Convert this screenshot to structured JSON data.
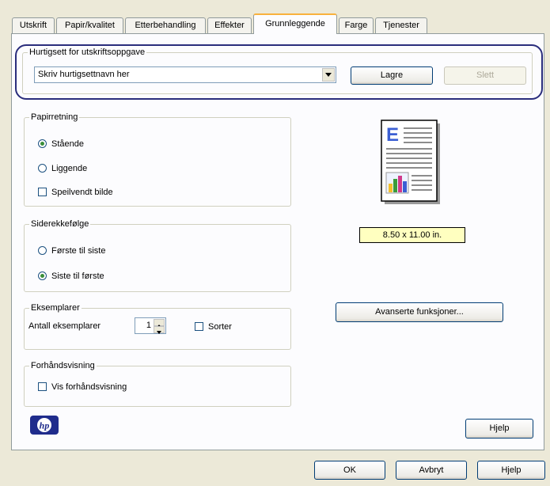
{
  "tabs": [
    {
      "label": "Utskrift"
    },
    {
      "label": "Papir/kvalitet"
    },
    {
      "label": "Etterbehandling"
    },
    {
      "label": "Effekter"
    },
    {
      "label": "Grunnleggende",
      "active": true
    },
    {
      "label": "Farge"
    },
    {
      "label": "Tjenester"
    }
  ],
  "quickset": {
    "title": "Hurtigsett for utskriftsoppgave",
    "value": "Skriv hurtigsettnavn her",
    "save_label": "Lagre",
    "delete_label": "Slett"
  },
  "orientation": {
    "title": "Papirretning",
    "portrait": "Stående",
    "landscape": "Liggende",
    "mirror": "Speilvendt bilde",
    "selected": "portrait"
  },
  "page_order": {
    "title": "Siderekkefølge",
    "first_to_last": "Første til siste",
    "last_to_first": "Siste til første",
    "selected": "last_to_first"
  },
  "copies": {
    "title": "Eksemplarer",
    "label": "Antall eksemplarer",
    "value": "1",
    "collate_label": "Sorter"
  },
  "preview": {
    "title": "Forhåndsvisning",
    "show_label": "Vis forhåndsvisning"
  },
  "paper_size": "8.50 x 11.00 in.",
  "advanced_label": "Avanserte funksjoner...",
  "help_label": "Hjelp",
  "footer": {
    "ok": "OK",
    "cancel": "Avbryt",
    "help": "Hjelp"
  },
  "colors": {
    "accent": "#2a2d7c",
    "tab_highlight": "#f8b13c",
    "paper_label_bg": "#ffffc0"
  }
}
